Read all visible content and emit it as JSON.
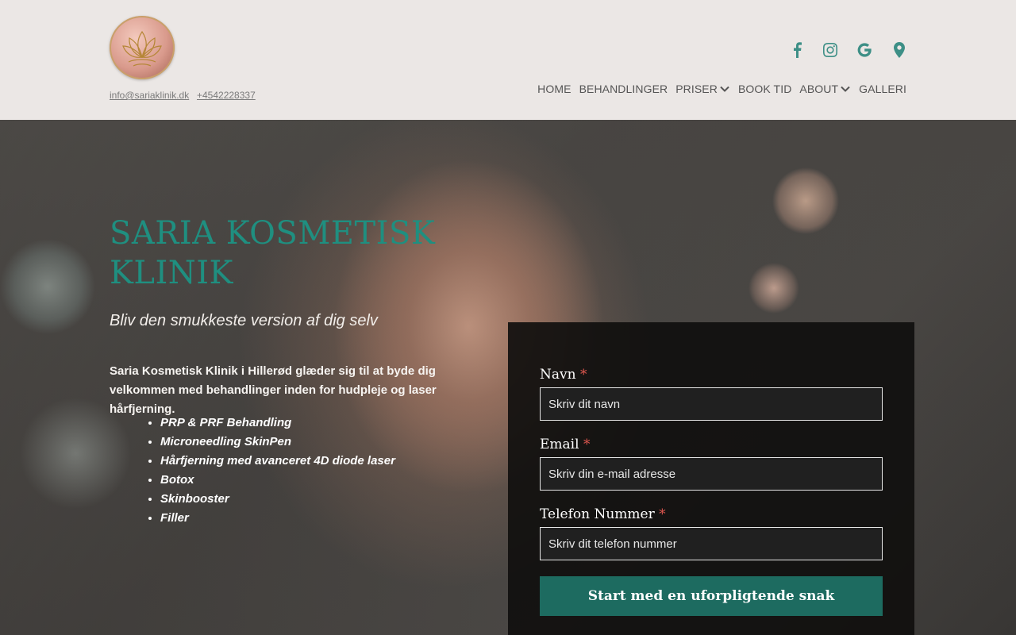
{
  "header": {
    "logo_alt": "Saria Kosmetisk Klinik logo",
    "email": "info@sariaklinik.dk",
    "phone": "+4542228337",
    "social_icons": [
      "facebook-icon",
      "instagram-icon",
      "google-icon",
      "map-pin-icon"
    ],
    "accent_color": "#3d8f86"
  },
  "nav": {
    "items": [
      {
        "label": "HOME",
        "has_dropdown": false
      },
      {
        "label": "BEHANDLINGER",
        "has_dropdown": false
      },
      {
        "label": "PRISER",
        "has_dropdown": true
      },
      {
        "label": "BOOK TID",
        "has_dropdown": false
      },
      {
        "label": "ABOUT",
        "has_dropdown": true
      },
      {
        "label": "GALLERI",
        "has_dropdown": false
      }
    ]
  },
  "hero": {
    "title": "SARIA KOSMETISK KLINIK",
    "subtitle": "Bliv den smukkeste version af dig selv",
    "intro": "Saria Kosmetisk Klinik i Hillerød glæder sig til at byde dig velkommen med behandlinger inden for hudpleje og laser hårfjerning.",
    "treatments": [
      "PRP & PRF Behandling",
      "Microneedling SkinPen",
      "Hårfjerning med avanceret 4D diode laser",
      "Botox",
      "Skinbooster",
      "Filler"
    ],
    "title_color": "#1f8f80"
  },
  "form": {
    "name_label": "Navn",
    "name_placeholder": "Skriv dit navn",
    "email_label": "Email",
    "email_placeholder": "Skriv din e-mail adresse",
    "phone_label": "Telefon Nummer",
    "phone_placeholder": "Skriv dit telefon nummer",
    "required_marker": "*",
    "submit_label": "Start med en uforpligtende snak",
    "button_color": "#1d6b60"
  }
}
